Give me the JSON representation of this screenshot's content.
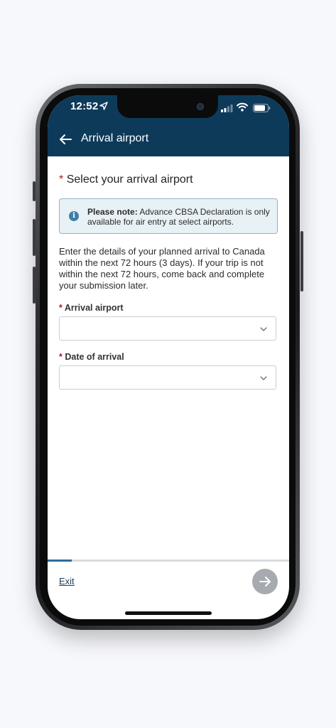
{
  "status_bar": {
    "time": "12:52",
    "location_icon": "location-arrow-icon",
    "signal_icon": "cellular-signal-icon",
    "wifi_icon": "wifi-icon",
    "battery_icon": "battery-icon"
  },
  "header": {
    "back_icon": "arrow-left-icon",
    "title": "Arrival airport"
  },
  "page": {
    "required_mark": "*",
    "title": "Select your arrival airport"
  },
  "note": {
    "icon": "info-icon",
    "icon_glyph": "i",
    "label": "Please note:",
    "text": " Advance CBSA Declaration is only available for air entry at select airports."
  },
  "intro_text": "Enter the details of your planned arrival to Canada within the next 72 hours (3 days). If your trip is not within the next 72 hours, come back and complete your submission later.",
  "fields": {
    "arrival_airport": {
      "required_mark": "*",
      "label": "Arrival airport",
      "value": ""
    },
    "date_of_arrival": {
      "required_mark": "*",
      "label": "Date of arrival",
      "value": ""
    }
  },
  "footer": {
    "exit_label": "Exit",
    "next_icon": "arrow-right-icon",
    "progress_fraction": 0.1
  },
  "colors": {
    "header_bg": "#0e3a5a",
    "required": "#a61d24",
    "note_bg": "#e8f1f5",
    "note_border": "#8fb4c7",
    "progress": "#2a6e99",
    "next_button_disabled": "#a7abb0"
  }
}
